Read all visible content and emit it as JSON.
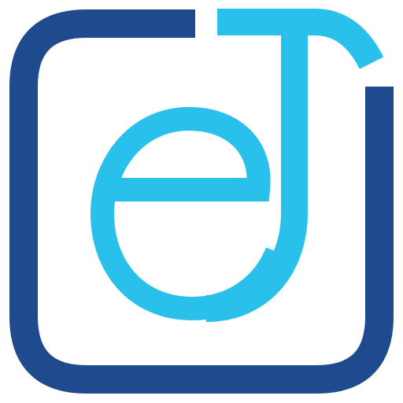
{
  "logo": {
    "mark": "eJ",
    "colors": {
      "frame": "#1F4A8C",
      "letters": "#29C0EC",
      "background": "#ffffff"
    }
  }
}
